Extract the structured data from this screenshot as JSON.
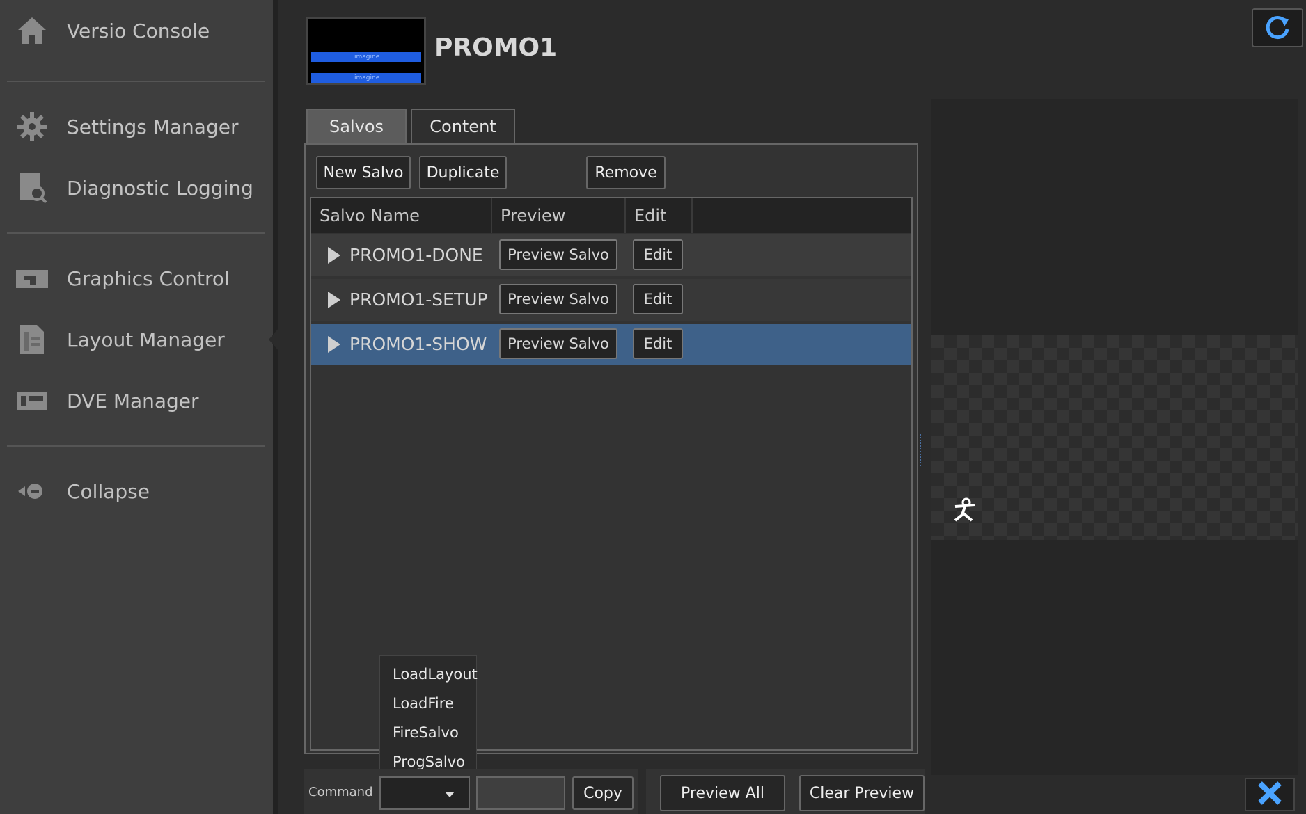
{
  "sidebar": {
    "items": [
      {
        "label": "Versio Console",
        "icon": "home-icon"
      },
      {
        "label": "Settings Manager",
        "icon": "gear-icon"
      },
      {
        "label": "Diagnostic Logging",
        "icon": "log-search-icon"
      },
      {
        "label": "Graphics Control",
        "icon": "graphics-icon"
      },
      {
        "label": "Layout Manager",
        "icon": "layout-icon"
      },
      {
        "label": "DVE Manager",
        "icon": "dve-icon"
      },
      {
        "label": "Collapse",
        "icon": "collapse-icon"
      }
    ]
  },
  "header": {
    "title": "PROMO1",
    "thumbnail_text": "imagine"
  },
  "tabs": [
    {
      "label": "Salvos",
      "active": true
    },
    {
      "label": "Content",
      "active": false
    }
  ],
  "toolbar": {
    "new_label": "New Salvo",
    "duplicate_label": "Duplicate",
    "remove_label": "Remove"
  },
  "table": {
    "columns": [
      "Salvo Name",
      "Preview",
      "Edit"
    ],
    "rows": [
      {
        "name": "PROMO1-DONE",
        "preview": "Preview Salvo",
        "edit": "Edit",
        "selected": false
      },
      {
        "name": "PROMO1-SETUP",
        "preview": "Preview Salvo",
        "edit": "Edit",
        "selected": false
      },
      {
        "name": "PROMO1-SHOW",
        "preview": "Preview Salvo",
        "edit": "Edit",
        "selected": true
      }
    ]
  },
  "command_menu": {
    "options": [
      "LoadLayout",
      "LoadFire",
      "FireSalvo",
      "ProgSalvo"
    ]
  },
  "command_bar": {
    "label": "Command",
    "selected": "",
    "input_value": "",
    "copy_label": "Copy",
    "preview_all_label": "Preview All",
    "clear_preview_label": "Clear Preview"
  },
  "colors": {
    "selected_row": "#3e6189",
    "accent_blue": "#1f5de0"
  }
}
